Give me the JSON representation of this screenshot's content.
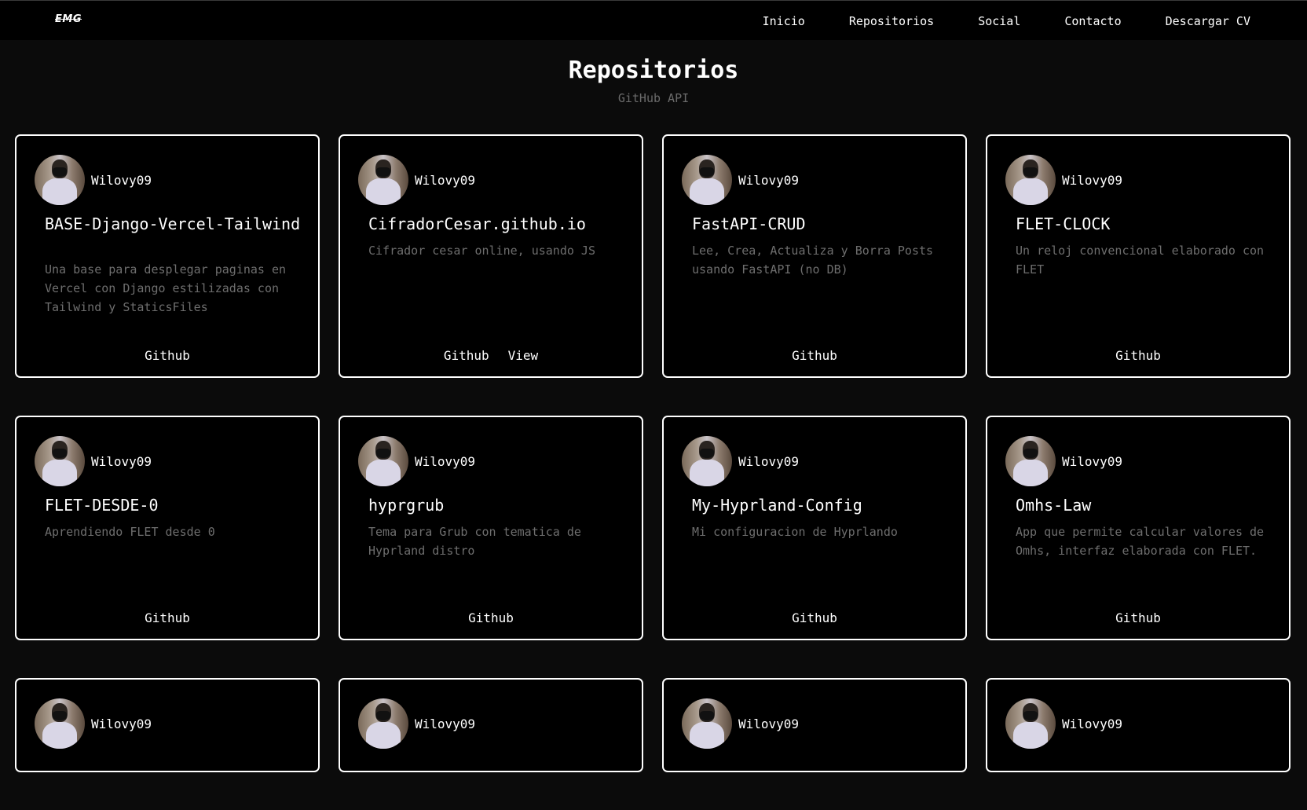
{
  "nav": {
    "logo": "EMG",
    "links": [
      "Inicio",
      "Repositorios",
      "Social",
      "Contacto",
      "Descargar CV"
    ]
  },
  "header": {
    "title": "Repositorios",
    "subtitle": "GitHub API"
  },
  "repos": [
    {
      "owner": "Wilovy09",
      "name": "BASE-Django-Vercel-Tailwind",
      "description": "Una base para desplegar paginas en Vercel con Django estilizadas con Tailwind y StaticsFiles",
      "links": [
        "Github"
      ]
    },
    {
      "owner": "Wilovy09",
      "name": "CifradorCesar.github.io",
      "description": "Cifrador cesar online, usando JS",
      "links": [
        "Github",
        "View"
      ]
    },
    {
      "owner": "Wilovy09",
      "name": "FastAPI-CRUD",
      "description": "Lee, Crea, Actualiza y Borra Posts usando FastAPI (no DB)",
      "links": [
        "Github"
      ]
    },
    {
      "owner": "Wilovy09",
      "name": "FLET-CLOCK",
      "description": "Un reloj convencional elaborado con FLET",
      "links": [
        "Github"
      ]
    },
    {
      "owner": "Wilovy09",
      "name": "FLET-DESDE-0",
      "description": "Aprendiendo FLET desde 0",
      "links": [
        "Github"
      ]
    },
    {
      "owner": "Wilovy09",
      "name": "hyprgrub",
      "description": "Tema para Grub con tematica de Hyprland distro",
      "links": [
        "Github"
      ]
    },
    {
      "owner": "Wilovy09",
      "name": "My-Hyprland-Config",
      "description": "Mi configuracion de Hyprlando",
      "links": [
        "Github"
      ]
    },
    {
      "owner": "Wilovy09",
      "name": "Omhs-Law",
      "description": "App que permite calcular valores de Omhs, interfaz elaborada con FLET.",
      "links": [
        "Github"
      ]
    },
    {
      "owner": "Wilovy09"
    },
    {
      "owner": "Wilovy09"
    },
    {
      "owner": "Wilovy09"
    },
    {
      "owner": "Wilovy09"
    }
  ]
}
